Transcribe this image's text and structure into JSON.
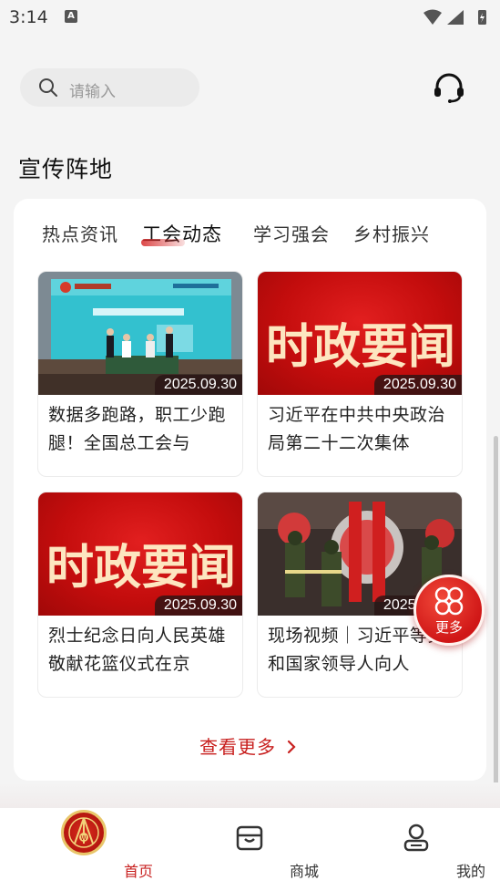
{
  "status_bar": {
    "time": "3:14",
    "notif_glyph": "A"
  },
  "search": {
    "placeholder": "请输入"
  },
  "section": {
    "title": "宣传阵地"
  },
  "tabs": [
    {
      "label": "热点资讯",
      "active": false
    },
    {
      "label": "工会动态",
      "active": true
    },
    {
      "label": "学习强会",
      "active": false
    },
    {
      "label": "乡村振兴",
      "active": false
    }
  ],
  "news": [
    {
      "title": "数据多跑路，职工少跑腿！全国总工会与",
      "date": "2025.09.30",
      "thumb": "signing-ceremony-photo"
    },
    {
      "title": "习近平在中共中央政治局第二十二次集体",
      "date": "2025.09.30",
      "thumb_text": "时政要闻"
    },
    {
      "title": "烈士纪念日向人民英雄敬献花篮仪式在京",
      "date": "2025.09.30",
      "thumb_text": "时政要闻"
    },
    {
      "title": "现场视频｜习近平等党和国家领导人向人",
      "date": "2025.09.30",
      "thumb": "honor-guard-wreath-photo"
    }
  ],
  "more_link": "查看更多",
  "float_button": {
    "label": "更多"
  },
  "bottom_nav": [
    {
      "label": "首页",
      "icon": "union-emblem-icon",
      "active": true
    },
    {
      "label": "商城",
      "icon": "shop-icon",
      "active": false
    },
    {
      "label": "我的",
      "icon": "user-icon",
      "active": false
    }
  ],
  "colors": {
    "accent": "#c8201f",
    "background": "#f4f4f4"
  }
}
